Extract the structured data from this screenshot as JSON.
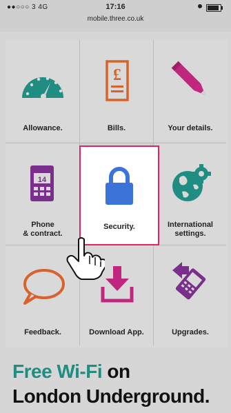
{
  "status_bar": {
    "signal": "●●○○○ 3  4G",
    "time": "17:16",
    "url": "mobile.three.co.uk"
  },
  "tiles": [
    {
      "label": "Allowance.",
      "icon": "speedometer-icon"
    },
    {
      "label": "Bills.",
      "icon": "bill-pound-icon"
    },
    {
      "label": "Your details.",
      "icon": "pencil-icon"
    },
    {
      "label": "Phone\n& contract.",
      "icon": "phone-calendar-icon",
      "day": "14"
    },
    {
      "label": "Security.",
      "icon": "padlock-icon"
    },
    {
      "label": "International\nsettings.",
      "icon": "globe-gear-icon"
    },
    {
      "label": "Feedback.",
      "icon": "speech-bubble-icon"
    },
    {
      "label": "Download App.",
      "icon": "download-icon"
    },
    {
      "label": "Upgrades.",
      "icon": "phone-upgrade-icon"
    }
  ],
  "banner": {
    "line1_a": "Free Wi-Fi",
    "line1_b": " on",
    "line2": "London Underground."
  },
  "colors": {
    "teal": "#1f8d82",
    "orange": "#d8622b",
    "magenta": "#c0267e",
    "purple": "#7b2f8c",
    "blue": "#3b73d9",
    "highlight": "#e2235f"
  }
}
